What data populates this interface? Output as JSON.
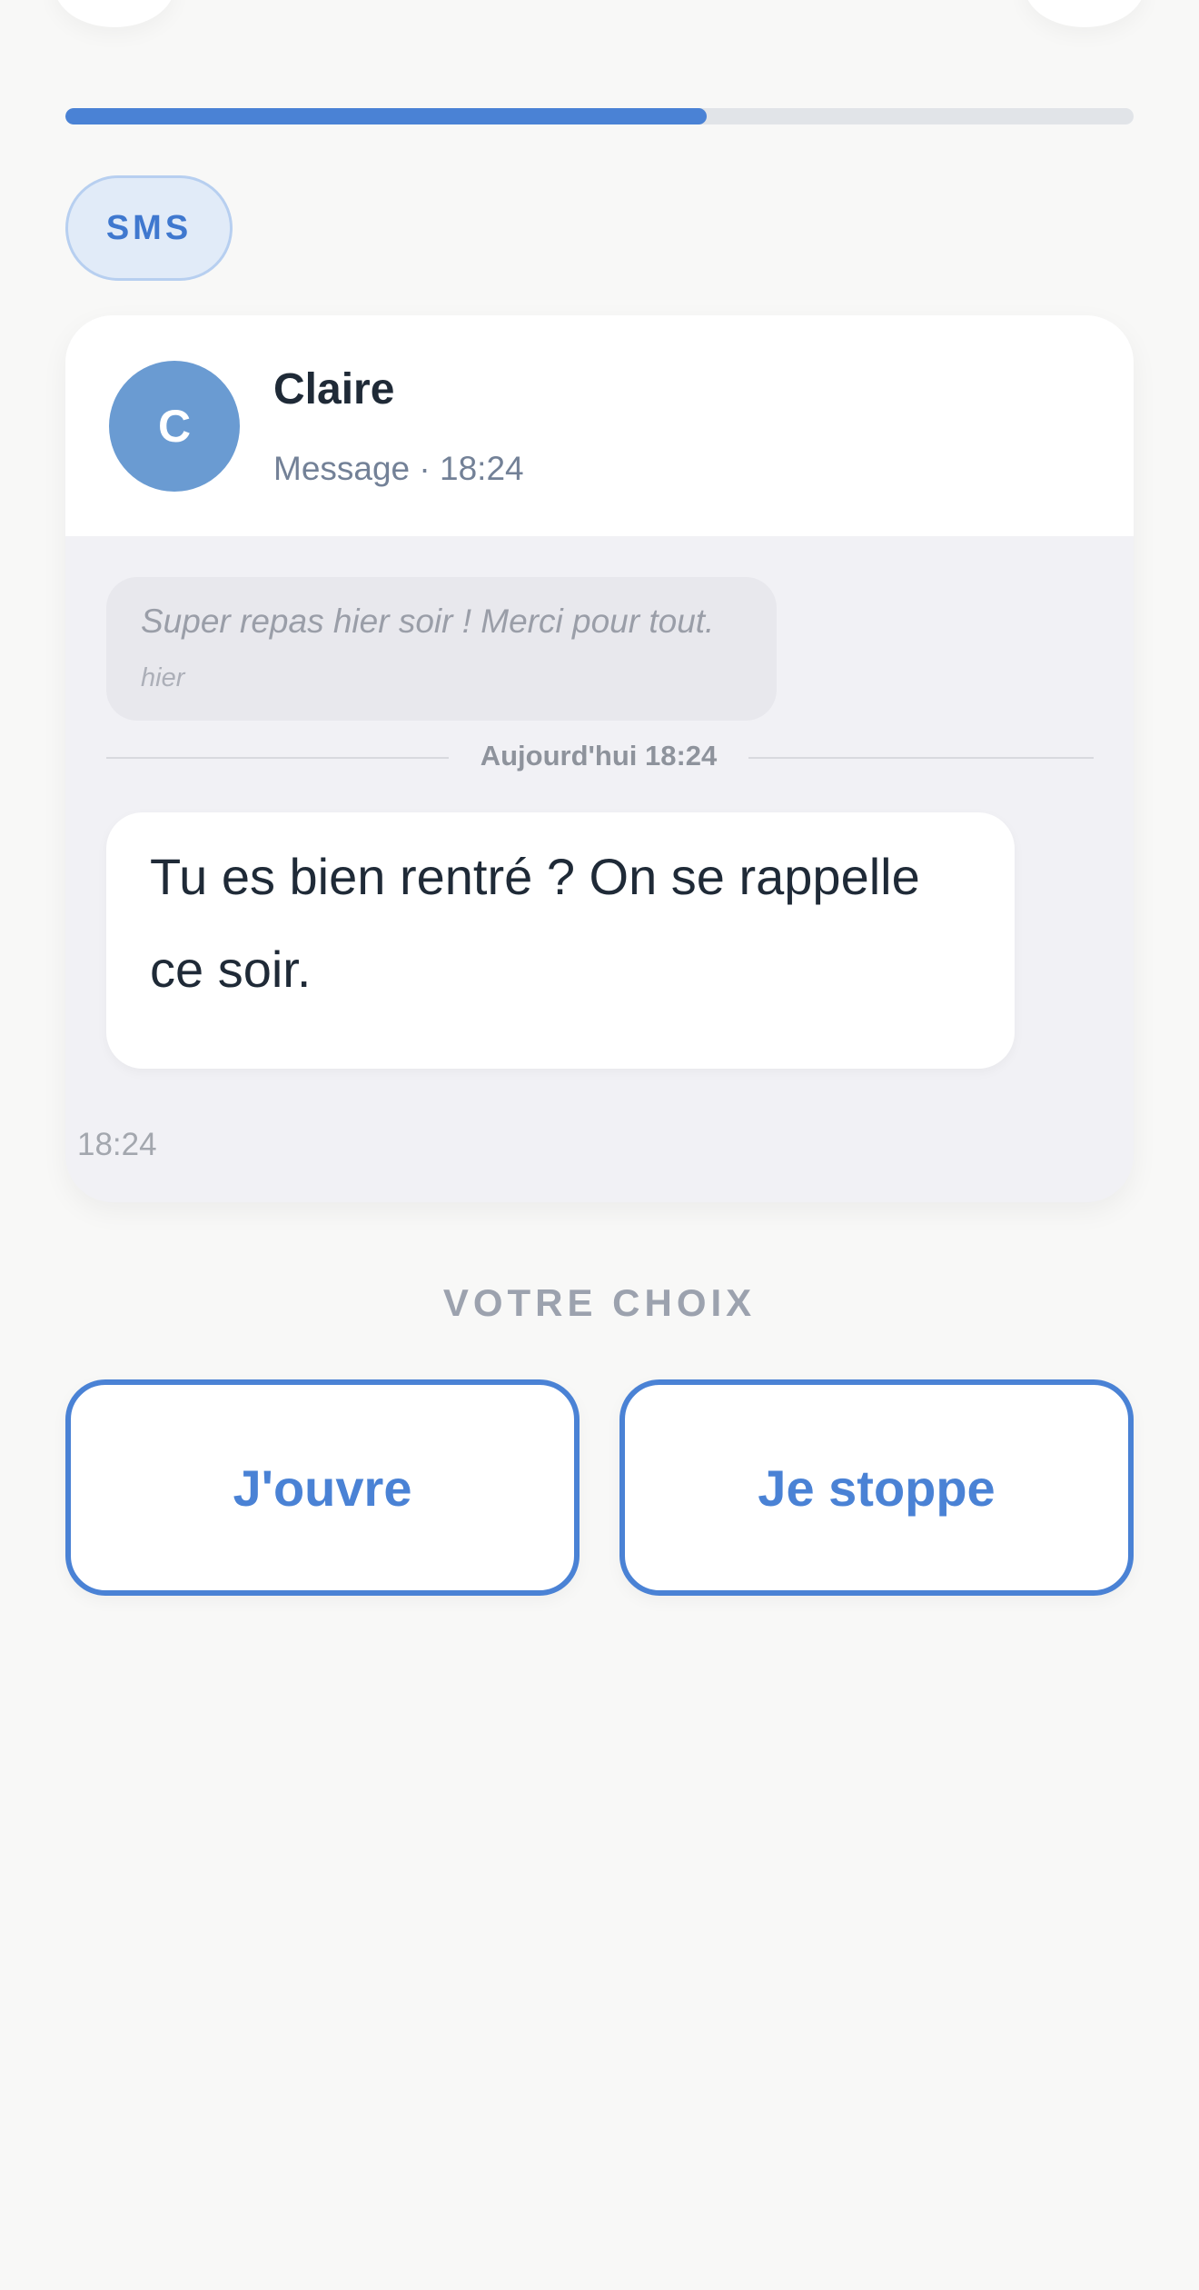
{
  "progress": {
    "fraction": 0.6,
    "color": "#4a82d5"
  },
  "channel_badge": "SMS",
  "sender": {
    "initial": "C",
    "name": "Claire",
    "meta": "Message · 18:24",
    "avatar_color": "#6a9bd2"
  },
  "previous_message": {
    "text": "Super repas hier soir ! Merci pour tout.",
    "time": "hier"
  },
  "divider_label": "Aujourd'hui 18:24",
  "message": {
    "text": "Tu es bien rentré ? On se rappelle ce soir."
  },
  "card_time": "18:24",
  "choice": {
    "label": "VOTRE CHOIX",
    "options": [
      "J'ouvre",
      "Je stoppe"
    ]
  }
}
